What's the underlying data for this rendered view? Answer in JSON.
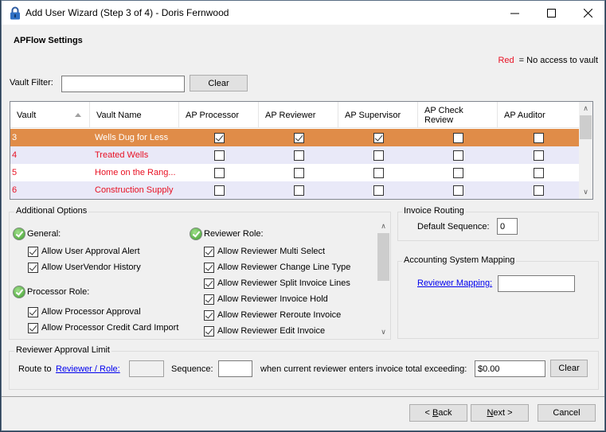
{
  "window": {
    "title": "Add User Wizard (Step 3 of 4) - Doris Fernwood",
    "icon": "padlock-icon",
    "controls": {
      "minimize": "minimize-icon",
      "maximize": "maximize-icon",
      "close": "close-icon"
    }
  },
  "section_title": "APFlow Settings",
  "legend": {
    "red_label": "Red",
    "text": "= No access to vault",
    "red_color": "#e81123"
  },
  "vault_filter": {
    "label": "Vault Filter:",
    "value": "",
    "placeholder": "",
    "clear_label": "Clear"
  },
  "grid": {
    "columns": [
      "Vault",
      "Vault Name",
      "AP Processor",
      "AP Reviewer",
      "AP Supervisor",
      "AP Check Review",
      "AP Auditor"
    ],
    "sort_column": "Vault",
    "sort_direction": "ascending",
    "selected_color": "#e08c48",
    "rows": [
      {
        "vault": "3",
        "name": "Wells Dug for Less",
        "no_access": false,
        "selected": true,
        "ap_processor": true,
        "ap_reviewer": true,
        "ap_supervisor": true,
        "ap_check_review": false,
        "ap_auditor": false
      },
      {
        "vault": "4",
        "name": "Treated Wells",
        "no_access": true,
        "selected": false,
        "ap_processor": false,
        "ap_reviewer": false,
        "ap_supervisor": false,
        "ap_check_review": false,
        "ap_auditor": false
      },
      {
        "vault": "5",
        "name": "Home on the Rang...",
        "no_access": true,
        "selected": false,
        "ap_processor": false,
        "ap_reviewer": false,
        "ap_supervisor": false,
        "ap_check_review": false,
        "ap_auditor": false
      },
      {
        "vault": "6",
        "name": "Construction Supply",
        "no_access": true,
        "selected": false,
        "ap_processor": false,
        "ap_reviewer": false,
        "ap_supervisor": false,
        "ap_check_review": false,
        "ap_auditor": false
      }
    ]
  },
  "additional_options": {
    "title": "Additional Options",
    "general": {
      "label": "General:",
      "options": [
        {
          "label": "Allow User Approval Alert",
          "checked": true
        },
        {
          "label": "Allow UserVendor History",
          "checked": true
        }
      ]
    },
    "processor_role": {
      "label": "Processor Role:",
      "options": [
        {
          "label": "Allow Processor Approval",
          "checked": true
        },
        {
          "label": "Allow Processor Credit Card Import",
          "checked": true
        }
      ]
    },
    "reviewer_role": {
      "label": "Reviewer Role:",
      "options": [
        {
          "label": "Allow Reviewer Multi Select",
          "checked": true
        },
        {
          "label": "Allow Reviewer Change Line Type",
          "checked": true
        },
        {
          "label": "Allow Reviewer Split Invoice Lines",
          "checked": true
        },
        {
          "label": "Allow Reviewer Invoice Hold",
          "checked": true
        },
        {
          "label": "Allow Reviewer Reroute Invoice",
          "checked": true
        },
        {
          "label": "Allow Reviewer Edit Invoice",
          "checked": true
        }
      ]
    }
  },
  "invoice_routing": {
    "title": "Invoice Routing",
    "default_sequence_label": "Default Sequence:",
    "default_sequence_value": "0"
  },
  "accounting_mapping": {
    "title": "Accounting System Mapping",
    "reviewer_mapping_label": "Reviewer Mapping:",
    "reviewer_mapping_value": ""
  },
  "approval_limit": {
    "title": "Reviewer Approval Limit",
    "route_to_label": "Route to",
    "reviewer_role_link": "Reviewer / Role:",
    "reviewer_role_value": "",
    "sequence_label": "Sequence:",
    "sequence_value": "",
    "exceeding_label": "when current reviewer enters invoice total exceeding:",
    "amount_value": "$0.00",
    "clear_label": "Clear"
  },
  "footer": {
    "back_prefix": "< ",
    "back_accel": "B",
    "back_rest": "ack",
    "next_accel": "N",
    "next_rest": "ext >",
    "cancel_label": "Cancel"
  }
}
